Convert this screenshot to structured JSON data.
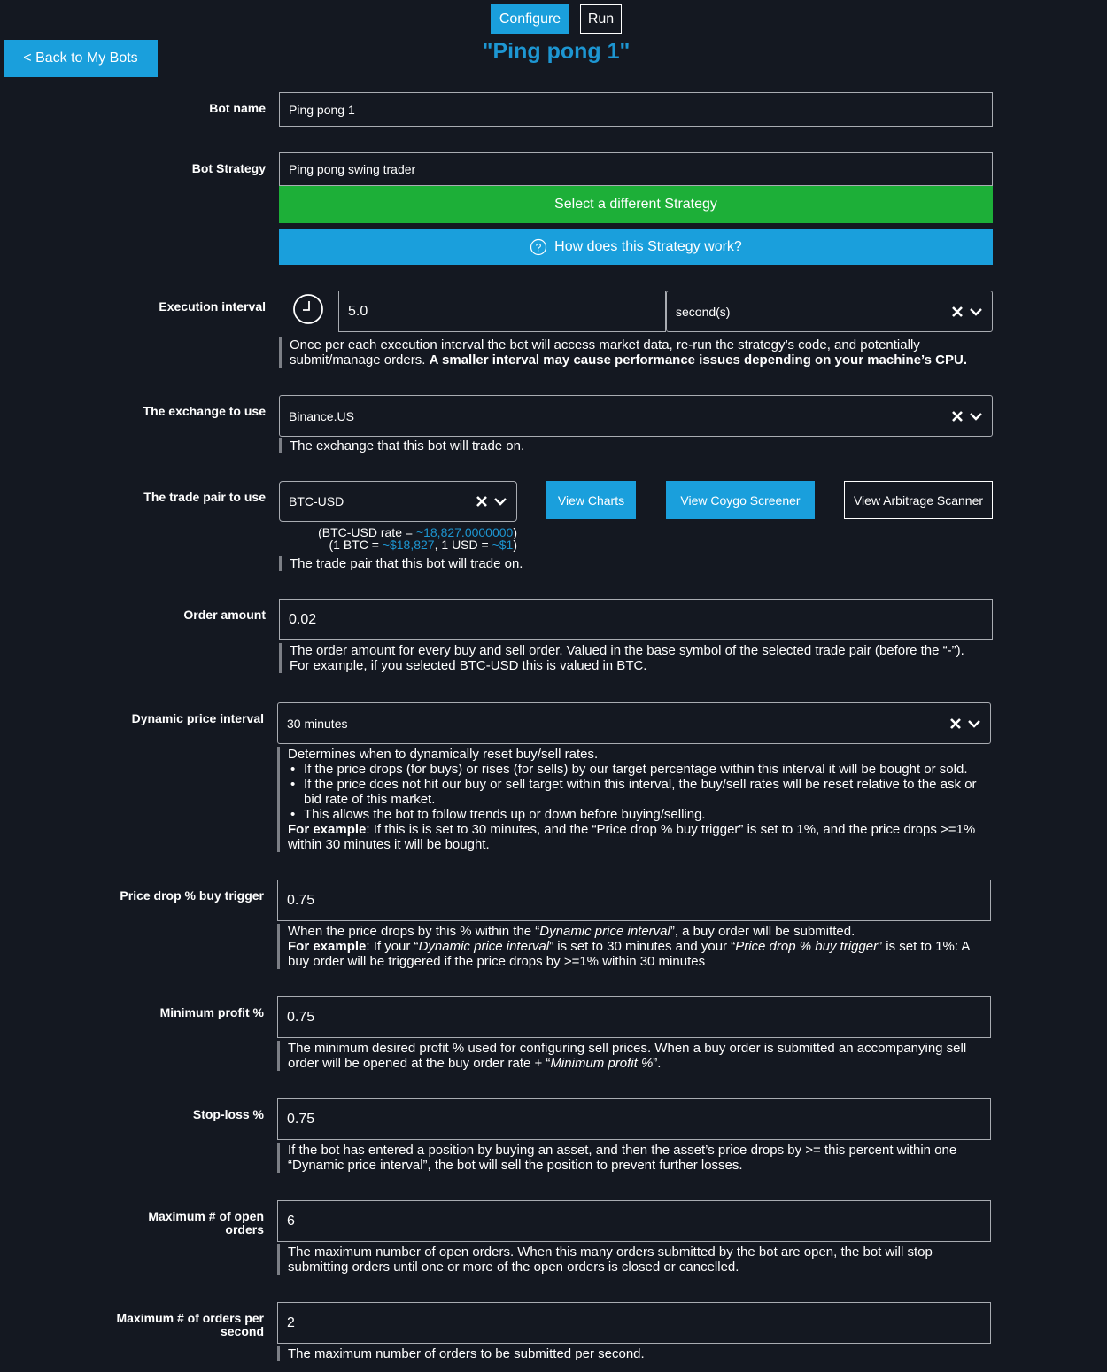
{
  "header": {
    "tabs": [
      {
        "label": "Configure",
        "active": true
      },
      {
        "label": "Run",
        "active": false
      }
    ],
    "title": "\"Ping pong 1\"",
    "back_button": "< Back to My Bots"
  },
  "colors": {
    "background": "#141821",
    "accent_blue": "#1a9fdc",
    "title_blue": "#1d96d2",
    "green": "#1daf38",
    "border": "#a9acb2"
  },
  "form": {
    "bot_name": {
      "label": "Bot name",
      "value": "Ping pong 1"
    },
    "bot_strategy": {
      "label": "Bot Strategy",
      "value": "Ping pong swing trader",
      "select_button": "Select a different Strategy",
      "how_button": "How does this Strategy work?",
      "how_icon": "question-circle-icon"
    },
    "execution_interval": {
      "label": "Execution interval",
      "icon": "clock-icon",
      "value": "5.0",
      "unit": "second(s)",
      "help_plain": "Once per each execution interval the bot will access market data, re-run the strategy’s code, and potentially submit/manage orders. ",
      "help_bold": "A smaller interval may cause performance issues depending on your machine’s CPU."
    },
    "exchange": {
      "label": "The exchange to use",
      "value": "Binance.US",
      "help": "The exchange that this bot will trade on."
    },
    "trade_pair": {
      "label": "The trade pair to use",
      "value": "BTC-USD",
      "buttons": [
        "View Charts",
        "View Coygo Screener",
        "View Arbitrage Scanner"
      ],
      "rate_prefix": "(BTC-USD rate = ",
      "rate_value": "~18,827.0000000",
      "rate_suffix": ")",
      "conv_prefix": "(1 BTC = ",
      "conv_btc": "~$18,827",
      "conv_mid": ", 1 USD = ",
      "conv_usd": "~$1",
      "conv_suffix": ")",
      "help": "The trade pair that this bot will trade on."
    },
    "order_amount": {
      "label": "Order amount",
      "value": "0.02",
      "help_line1": "The order amount for every buy and sell order. Valued in the base symbol of the selected trade pair (before the “-”).",
      "help_line2": "For example, if you selected BTC-USD this is valued in BTC."
    },
    "dynamic_price_interval": {
      "label": "Dynamic price interval",
      "value": "30 minutes",
      "help_intro": "Determines when to dynamically reset buy/sell rates.",
      "help_bullets": [
        "If the price drops (for buys) or rises (for sells) by our target percentage within this interval it will be bought or sold.",
        "If the price does not hit our buy or sell target within this interval, the buy/sell rates will be reset relative to the ask or bid rate of this market.",
        "This allows the bot to follow trends up or down before buying/selling."
      ],
      "example_bold": "For example",
      "example_text": ": If this is is set to 30 minutes, and the “Price drop % buy trigger” is set to 1%, and the price drops >=1% within 30 minutes it will be bought."
    },
    "price_drop_trigger": {
      "label": "Price drop % buy trigger",
      "value": "0.75",
      "help_1a": "When the price drops by this % within the “",
      "help_1i": "Dynamic price interval",
      "help_1b": "”, a buy order will be submitted.",
      "example_bold": "For example",
      "help_2a": ": If your “",
      "help_2i": "Dynamic price interval",
      "help_2b": "” is set to 30 minutes and your “",
      "help_2i2": "Price drop % buy trigger",
      "help_2c": "” is set to 1%: A buy order will be triggered if the price drops by >=1% within 30 minutes"
    },
    "minimum_profit": {
      "label": "Minimum profit %",
      "value": "0.75",
      "help_a": "The minimum desired profit % used for configuring sell prices. When a buy order is submitted an accompanying sell order will be opened at the buy order rate + “",
      "help_i": "Minimum profit %",
      "help_b": "”."
    },
    "stop_loss": {
      "label": "Stop-loss %",
      "value": "0.75",
      "help": "If the bot has entered a position by buying an asset, and then the asset’s price drops by >= this percent within one “Dynamic price interval”, the bot will sell the position to prevent further losses."
    },
    "max_open_orders": {
      "label": "Maximum # of open orders",
      "value": "6",
      "help": "The maximum number of open orders. When this many orders submitted by the bot are open, the bot will stop submitting orders until one or more of the open orders is closed or cancelled."
    },
    "max_orders_per_second": {
      "label": "Maximum # of orders per second",
      "value": "2",
      "help": "The maximum number of orders to be submitted per second."
    }
  }
}
